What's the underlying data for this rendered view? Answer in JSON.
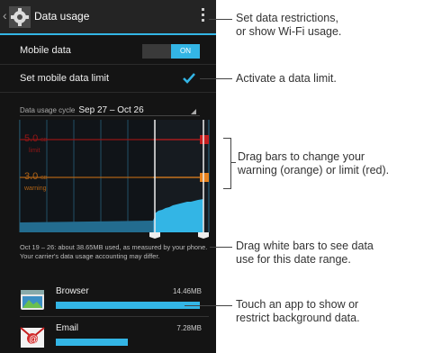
{
  "header": {
    "title": "Data usage"
  },
  "settings": {
    "mobile_data_label": "Mobile data",
    "mobile_data_state": "ON",
    "limit_label": "Set mobile data limit",
    "limit_checked": true
  },
  "cycle": {
    "label": "Data usage cycle",
    "value": "Sep 27 – Oct 26"
  },
  "chart": {
    "limit_value": "5.0",
    "limit_unit": "GB",
    "limit_label": "limit",
    "warning_value": "3.0",
    "warning_unit": "GB",
    "warning_label": "warning",
    "limit_color": "#c41e1e",
    "warning_color": "#e8831e",
    "accent": "#33b5e5"
  },
  "note": "Oct 19 – 26: about 38.65MB used, as measured by your phone. Your carrier's data usage accounting may differ.",
  "apps": [
    {
      "name": "Browser",
      "size": "14.46MB",
      "fraction": 1.0,
      "icon": "browser-icon"
    },
    {
      "name": "Email",
      "size": "7.28MB",
      "fraction": 0.5,
      "icon": "email-icon"
    }
  ],
  "callouts": {
    "menu": [
      "Set data restrictions,",
      "or show Wi-Fi usage."
    ],
    "limit": [
      "Activate a data limit."
    ],
    "drag": [
      "Drag bars to change your",
      "warning (orange) or limit (red)."
    ],
    "range": [
      "Drag white bars to see data",
      "use for this date range."
    ],
    "app": [
      "Touch an app to show or",
      "restrict background data."
    ]
  }
}
